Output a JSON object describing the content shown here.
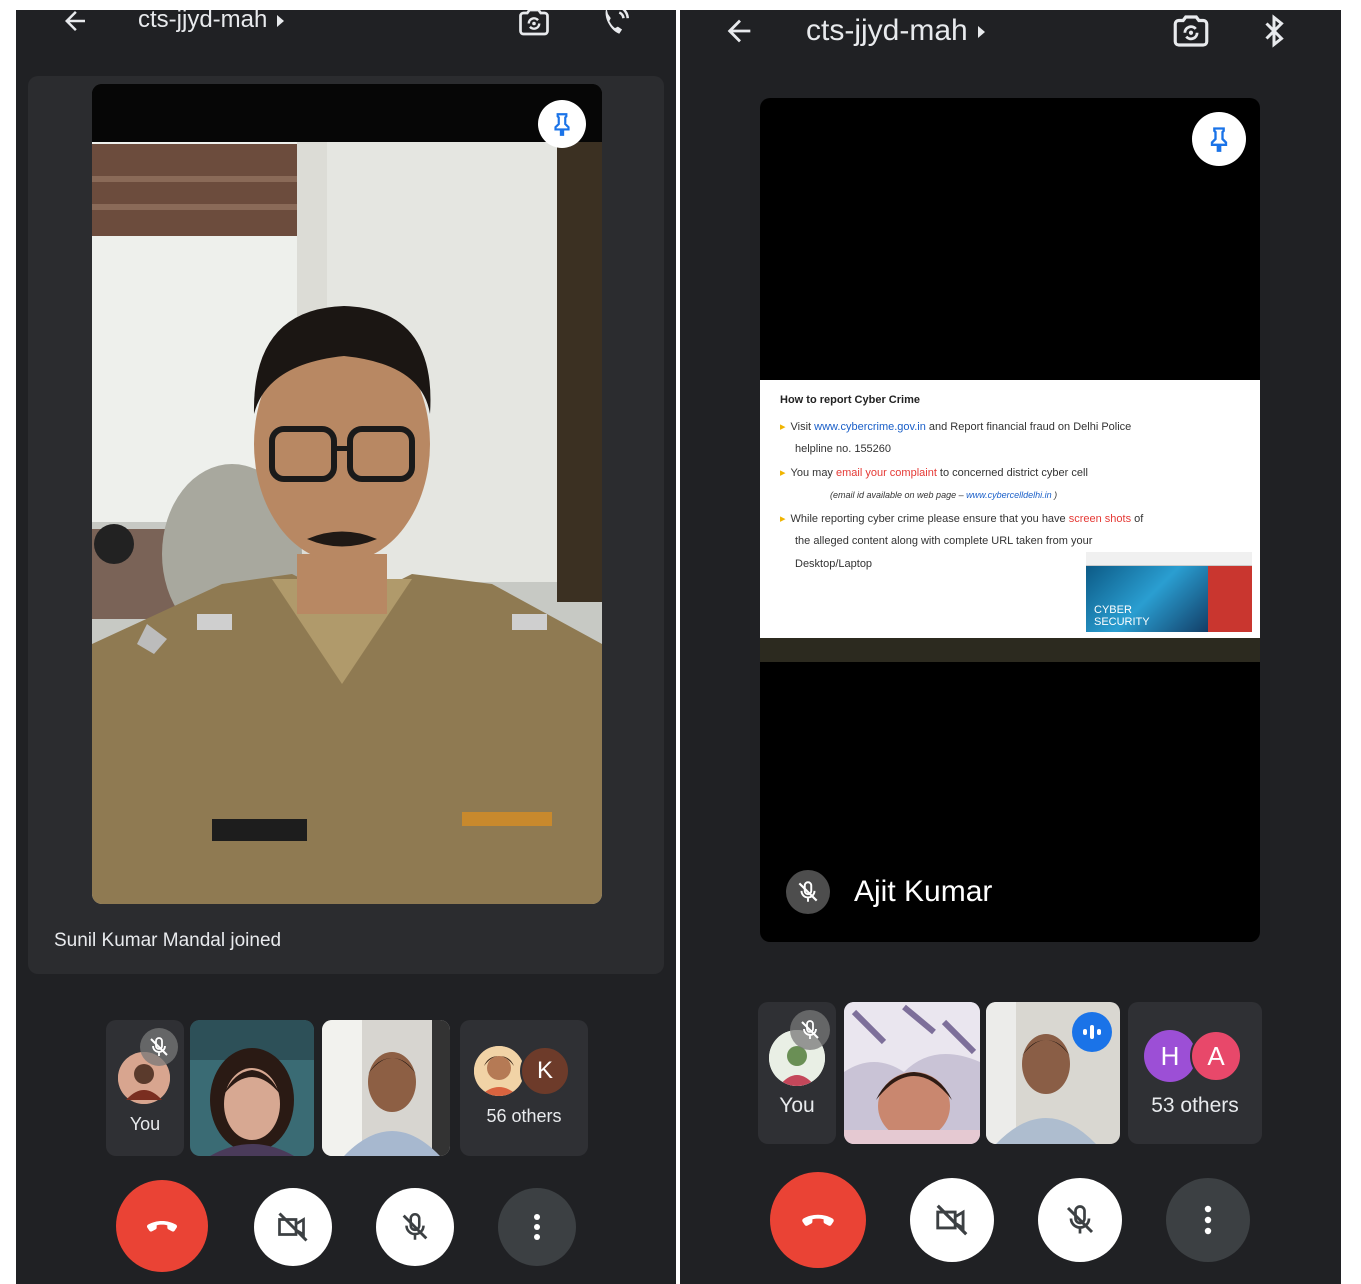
{
  "left": {
    "meeting_code": "cts-jjyd-mah",
    "toast": "Sunil Kumar Mandal joined",
    "tiles": {
      "you_label": "You",
      "others_label": "56 others",
      "others_avatar_letter": "K"
    }
  },
  "right": {
    "meeting_code": "cts-jjyd-mah",
    "presenter_name": "Ajit Kumar",
    "slide": {
      "heading": "How to report Cyber Crime",
      "b1_pre": "Visit ",
      "b1_link": "www.cybercrime.gov.in",
      "b1_post": " and Report financial fraud on Delhi Police",
      "b1_line2": "helpline no. 155260",
      "b2_pre": "You may ",
      "b2_red": "email your complaint",
      "b2_post": " to concerned district cyber cell",
      "b2_note_pre": "(email id available on web page – ",
      "b2_note_link": "www.cybercelldelhi.in",
      "b2_note_post": " )",
      "b3_pre": "While reporting cyber crime please ensure that you have ",
      "b3_red": "screen shots",
      "b3_post": " of",
      "b3_line2": "the alleged content along with complete URL taken from your",
      "b3_line3": "Desktop/Laptop",
      "cyber_line1": "CYBER",
      "cyber_line2": "SECURITY"
    },
    "tiles": {
      "you_label": "You",
      "others_label": "53 others",
      "avatar_h": "H",
      "avatar_a": "A"
    }
  },
  "colors": {
    "background": "#202124",
    "end_call": "#ea4335",
    "speaking_badge": "#1a73e8",
    "avatar_k": "#6d3b2a",
    "avatar_h": "#9c4fd6",
    "avatar_a": "#e8486a"
  },
  "icons": [
    "back-arrow-icon",
    "switch-camera-icon",
    "audio-output-icon",
    "bluetooth-icon",
    "pin-icon",
    "mic-off-icon",
    "camera-off-icon",
    "end-call-icon",
    "more-options-icon",
    "speaking-indicator-icon"
  ]
}
